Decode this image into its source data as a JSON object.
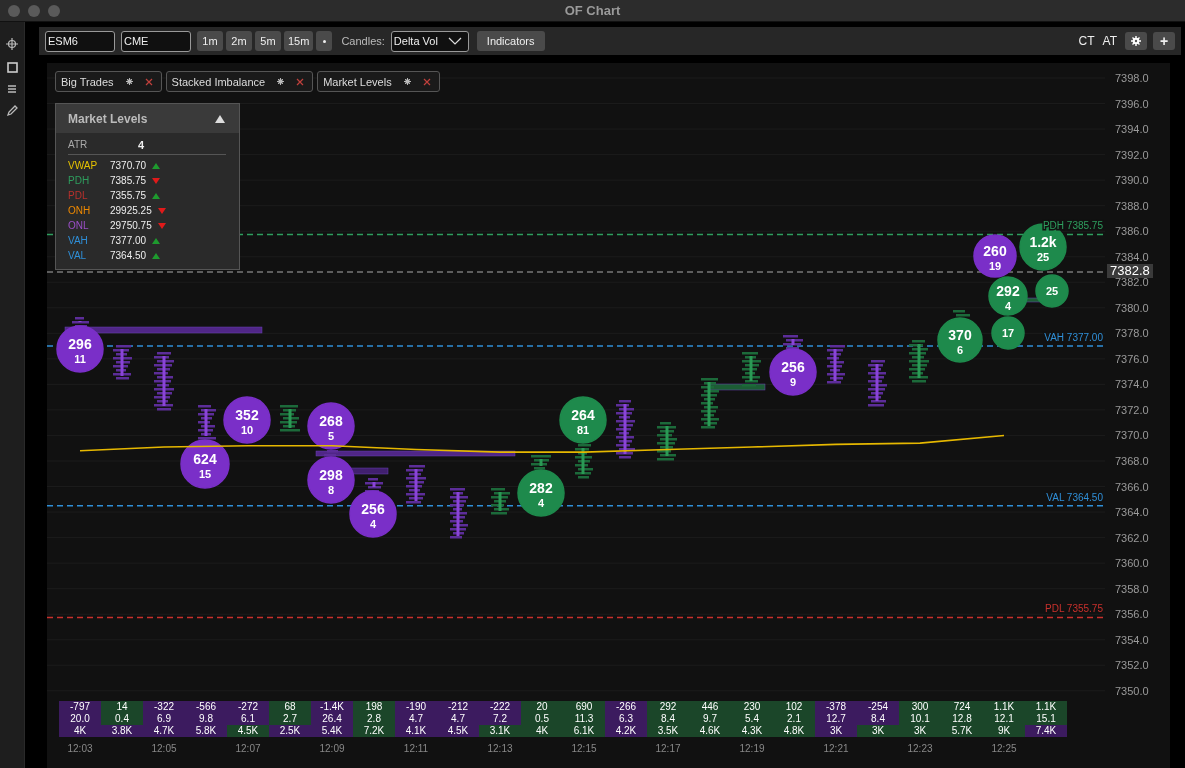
{
  "window": {
    "title": "OF Chart"
  },
  "toolbar": {
    "symbol": "ESM6",
    "exchange": "CME",
    "timeframes": [
      {
        "label": "1m",
        "selected": false
      },
      {
        "label": "2m",
        "selected": false
      },
      {
        "label": "5m",
        "selected": false
      },
      {
        "label": "15m",
        "selected": false
      }
    ],
    "candles_label": "Candles:",
    "candles_value": "Delta Vol",
    "indicators_button": "Indicators",
    "right_labels": [
      "CT",
      "AT"
    ],
    "add_button": "+"
  },
  "indicator_chips": [
    "Big Trades",
    "Stacked Imbalance",
    "Market Levels"
  ],
  "market_levels": {
    "title": "Market Levels",
    "expanded": true,
    "atr_label": "ATR",
    "atr_value": "4",
    "rows": [
      {
        "name": "VWAP",
        "color": "#e6c200",
        "value": "7370.70",
        "rising": true
      },
      {
        "name": "PDH",
        "color": "#2e9e5e",
        "value": "7385.75",
        "rising": false
      },
      {
        "name": "PDL",
        "color": "#b8302c",
        "value": "7355.75",
        "rising": true
      },
      {
        "name": "ONH",
        "color": "#f08a00",
        "value": "29925.25",
        "rising": false
      },
      {
        "name": "ONL",
        "color": "#9b4fc8",
        "value": "29750.75",
        "rising": false
      },
      {
        "name": "VAH",
        "color": "#2f8fd8",
        "value": "7377.00",
        "rising": true
      },
      {
        "name": "VAL",
        "color": "#2f8fd8",
        "value": "7364.50",
        "rising": true
      }
    ]
  },
  "chart": {
    "chart_data": {
      "type": "line",
      "ylim": [
        7350,
        7398
      ],
      "grid": true,
      "yticks": [
        {
          "value": 7398,
          "label": "7398.0"
        },
        {
          "value": 7396,
          "label": "7396.0"
        },
        {
          "value": 7394,
          "label": "7394.0"
        },
        {
          "value": 7392,
          "label": "7392.0"
        },
        {
          "value": 7390,
          "label": "7390.0"
        },
        {
          "value": 7388,
          "label": "7388.0"
        },
        {
          "value": 7386,
          "label": "7386.0"
        },
        {
          "value": 7384,
          "label": "7384.0"
        },
        {
          "value": 7382,
          "label": "7382.0"
        },
        {
          "value": 7380,
          "label": "7380.0"
        },
        {
          "value": 7378,
          "label": "7378.0"
        },
        {
          "value": 7376,
          "label": "7376.0"
        },
        {
          "value": 7374,
          "label": "7374.0"
        },
        {
          "value": 7372,
          "label": "7372.0"
        },
        {
          "value": 7370,
          "label": "7370.0"
        },
        {
          "value": 7368,
          "label": "7368.0"
        },
        {
          "value": 7366,
          "label": "7366.0"
        },
        {
          "value": 7364,
          "label": "7364.0"
        },
        {
          "value": 7362,
          "label": "7362.0"
        },
        {
          "value": 7360,
          "label": "7360.0"
        },
        {
          "value": 7358,
          "label": "7358.0"
        },
        {
          "value": 7356,
          "label": "7356.0"
        },
        {
          "value": 7354,
          "label": "7354.0"
        },
        {
          "value": 7352,
          "label": "7352.0"
        },
        {
          "value": 7350,
          "label": "7350.0"
        }
      ],
      "categories": [
        "12:03",
        "12:05",
        "12:07",
        "12:09",
        "12:11",
        "12:13",
        "12:15",
        "12:17",
        "12:19",
        "12:21",
        "12:23",
        "12:25"
      ],
      "series": [
        {
          "color": "#e6b800",
          "values": [
            7368.8,
            7369.1,
            7369.2,
            7369.2,
            7368.9,
            7368.7,
            7368.7,
            7368.9,
            7369.1,
            7369.3,
            7369.4,
            7370.0
          ]
        }
      ],
      "ref_lines": [
        {
          "axis": "y",
          "value": 7385.75,
          "label": "PDH 7385.75",
          "color": "#2e9e5e"
        },
        {
          "axis": "y",
          "value": 7382.8,
          "label": "7382.8",
          "color": "#777777"
        },
        {
          "axis": "y",
          "value": 7377,
          "label": "VAH 7377.00",
          "color": "#2f8fd8"
        },
        {
          "axis": "y",
          "value": 7364.5,
          "label": "VAL 7364.50",
          "color": "#2f8fd8"
        },
        {
          "axis": "y",
          "value": 7355.75,
          "label": "PDL 7355.75",
          "color": "#c8302c"
        }
      ]
    },
    "bubbles": [
      {
        "lines": [
          "296",
          "11"
        ],
        "color": "#7a2fc8"
      },
      {
        "lines": [
          "624",
          "15"
        ],
        "color": "#7a2fc8"
      },
      {
        "lines": [
          "352",
          "10"
        ],
        "color": "#7a2fc8"
      },
      {
        "lines": [
          "268",
          "5"
        ],
        "color": "#7a2fc8"
      },
      {
        "lines": [
          "298",
          "8"
        ],
        "color": "#7a2fc8"
      },
      {
        "lines": [
          "256",
          "4"
        ],
        "color": "#7a2fc8"
      },
      {
        "lines": [
          "282",
          "4"
        ],
        "color": "#1e8a4c"
      },
      {
        "lines": [
          "264",
          "81"
        ],
        "color": "#1e8a4c"
      },
      {
        "lines": [
          "256",
          "9"
        ],
        "color": "#7a2fc8"
      },
      {
        "lines": [
          "370",
          "6"
        ],
        "color": "#1e8a4c"
      },
      {
        "lines": [
          "17"
        ],
        "color": "#1e8a4c"
      },
      {
        "lines": [
          "260",
          "19"
        ],
        "color": "#7a2fc8"
      },
      {
        "lines": [
          "292",
          "4"
        ],
        "color": "#1e8a4c"
      },
      {
        "lines": [
          "25"
        ],
        "color": "#1e8a4c"
      },
      {
        "lines": [
          "1.2k",
          "25"
        ],
        "color": "#1e8a4c"
      }
    ]
  },
  "footer_columns": [
    {
      "cells": [
        {
          "text": "-797",
          "color": "#3c1b5f"
        },
        {
          "text": "20.0",
          "color": "#3c1b5f"
        },
        {
          "text": "4K",
          "color": "#3c1b5f"
        }
      ]
    },
    {
      "cells": [
        {
          "text": "14",
          "color": "#1b4629"
        },
        {
          "text": "0.4",
          "color": "#1b4629"
        },
        {
          "text": "3.8K",
          "color": "#3c1b5f"
        }
      ]
    },
    {
      "cells": [
        {
          "text": "-322",
          "color": "#3c1b5f"
        },
        {
          "text": "6.9",
          "color": "#3c1b5f"
        },
        {
          "text": "4.7K",
          "color": "#3c1b5f"
        }
      ]
    },
    {
      "cells": [
        {
          "text": "-566",
          "color": "#3c1b5f"
        },
        {
          "text": "9.8",
          "color": "#3c1b5f"
        },
        {
          "text": "5.8K",
          "color": "#3c1b5f"
        }
      ]
    },
    {
      "cells": [
        {
          "text": "-272",
          "color": "#3c1b5f"
        },
        {
          "text": "6.1",
          "color": "#3c1b5f"
        },
        {
          "text": "4.5K",
          "color": "#1b4629"
        }
      ]
    },
    {
      "cells": [
        {
          "text": "68",
          "color": "#1b4629"
        },
        {
          "text": "2.7",
          "color": "#1b4629"
        },
        {
          "text": "2.5K",
          "color": "#3c1b5f"
        }
      ]
    },
    {
      "cells": [
        {
          "text": "-1.4K",
          "color": "#3c1b5f"
        },
        {
          "text": "26.4",
          "color": "#3c1b5f"
        },
        {
          "text": "5.4K",
          "color": "#3c1b5f"
        }
      ]
    },
    {
      "cells": [
        {
          "text": "198",
          "color": "#1b4629"
        },
        {
          "text": "2.8",
          "color": "#1b4629"
        },
        {
          "text": "7.2K",
          "color": "#1b4629"
        }
      ]
    },
    {
      "cells": [
        {
          "text": "-190",
          "color": "#3c1b5f"
        },
        {
          "text": "4.7",
          "color": "#3c1b5f"
        },
        {
          "text": "4.1K",
          "color": "#3c1b5f"
        }
      ]
    },
    {
      "cells": [
        {
          "text": "-212",
          "color": "#3c1b5f"
        },
        {
          "text": "4.7",
          "color": "#3c1b5f"
        },
        {
          "text": "4.5K",
          "color": "#3c1b5f"
        }
      ]
    },
    {
      "cells": [
        {
          "text": "-222",
          "color": "#3c1b5f"
        },
        {
          "text": "7.2",
          "color": "#3c1b5f"
        },
        {
          "text": "3.1K",
          "color": "#1b4629"
        }
      ]
    },
    {
      "cells": [
        {
          "text": "20",
          "color": "#1b4629"
        },
        {
          "text": "0.5",
          "color": "#1b4629"
        },
        {
          "text": "4K",
          "color": "#1b4629"
        }
      ]
    },
    {
      "cells": [
        {
          "text": "690",
          "color": "#1b4629"
        },
        {
          "text": "11.3",
          "color": "#1b4629"
        },
        {
          "text": "6.1K",
          "color": "#1b4629"
        }
      ]
    },
    {
      "cells": [
        {
          "text": "-266",
          "color": "#3c1b5f"
        },
        {
          "text": "6.3",
          "color": "#3c1b5f"
        },
        {
          "text": "4.2K",
          "color": "#3c1b5f"
        }
      ]
    },
    {
      "cells": [
        {
          "text": "292",
          "color": "#1b4629"
        },
        {
          "text": "8.4",
          "color": "#1b4629"
        },
        {
          "text": "3.5K",
          "color": "#1b4629"
        }
      ]
    },
    {
      "cells": [
        {
          "text": "446",
          "color": "#1b4629"
        },
        {
          "text": "9.7",
          "color": "#1b4629"
        },
        {
          "text": "4.6K",
          "color": "#1b4629"
        }
      ]
    },
    {
      "cells": [
        {
          "text": "230",
          "color": "#1b4629"
        },
        {
          "text": "5.4",
          "color": "#1b4629"
        },
        {
          "text": "4.3K",
          "color": "#1b4629"
        }
      ]
    },
    {
      "cells": [
        {
          "text": "102",
          "color": "#1b4629"
        },
        {
          "text": "2.1",
          "color": "#1b4629"
        },
        {
          "text": "4.8K",
          "color": "#1b4629"
        }
      ]
    },
    {
      "cells": [
        {
          "text": "-378",
          "color": "#3c1b5f"
        },
        {
          "text": "12.7",
          "color": "#3c1b5f"
        },
        {
          "text": "3K",
          "color": "#3c1b5f"
        }
      ]
    },
    {
      "cells": [
        {
          "text": "-254",
          "color": "#3c1b5f"
        },
        {
          "text": "8.4",
          "color": "#3c1b5f"
        },
        {
          "text": "3K",
          "color": "#1b4629"
        }
      ]
    },
    {
      "cells": [
        {
          "text": "300",
          "color": "#1b4629"
        },
        {
          "text": "10.1",
          "color": "#1b4629"
        },
        {
          "text": "3K",
          "color": "#1b4629"
        }
      ]
    },
    {
      "cells": [
        {
          "text": "724",
          "color": "#1b4629"
        },
        {
          "text": "12.8",
          "color": "#1b4629"
        },
        {
          "text": "5.7K",
          "color": "#1b4629"
        }
      ]
    },
    {
      "cells": [
        {
          "text": "1.1K",
          "color": "#1b4629"
        },
        {
          "text": "12.1",
          "color": "#1b4629"
        },
        {
          "text": "9K",
          "color": "#1b4629"
        }
      ]
    },
    {
      "cells": [
        {
          "text": "1.1K",
          "color": "#1b4629"
        },
        {
          "text": "15.1",
          "color": "#1b4629"
        },
        {
          "text": "7.4K",
          "color": "#3c1b5f"
        }
      ]
    }
  ]
}
